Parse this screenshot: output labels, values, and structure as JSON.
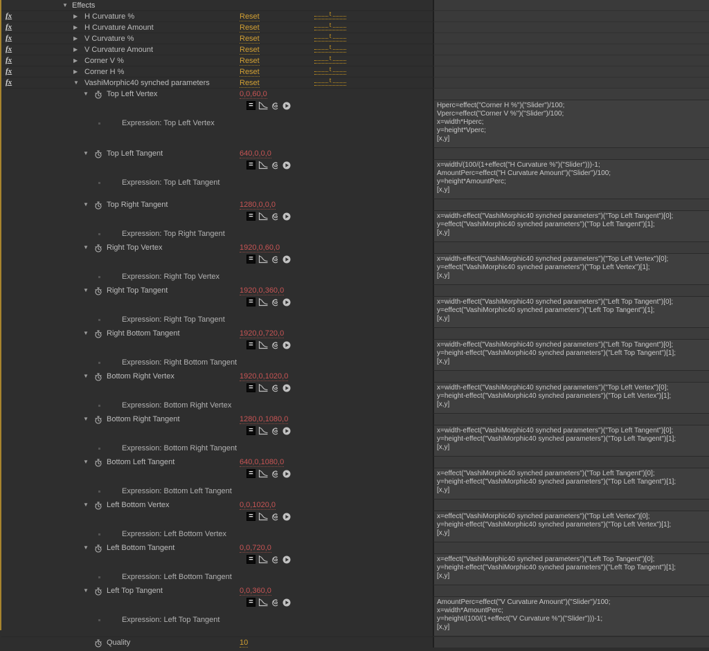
{
  "colors": {
    "hot_text_orange": "#d2a033",
    "keyframed_value_red": "#c75454",
    "panel_bg": "#2e2e2e",
    "track_bg": "#3a3a3a",
    "left_edge_accent": "#a8852e"
  },
  "icons": {
    "twirl_down": "▼",
    "twirl_right": "▶",
    "fx_badge": "fx",
    "enable_expression": "=",
    "post_expression_graph": "graph-curve",
    "pick_whip": "spiral",
    "expression_language_menu": "play-circle",
    "stopwatch": "stopwatch",
    "expression_dots_label": "t"
  },
  "effects_header": {
    "label": "Effects",
    "twirl": "▼"
  },
  "effects": [
    {
      "name": "H Curvature %",
      "twirl": "▶",
      "reset": "Reset"
    },
    {
      "name": "H Curvature Amount",
      "twirl": "▶",
      "reset": "Reset"
    },
    {
      "name": "V Curvature %",
      "twirl": "▶",
      "reset": "Reset"
    },
    {
      "name": "V Curvature Amount",
      "twirl": "▶",
      "reset": "Reset"
    },
    {
      "name": "Corner V %",
      "twirl": "▶",
      "reset": "Reset"
    },
    {
      "name": "Corner H %",
      "twirl": "▶",
      "reset": "Reset"
    },
    {
      "name": "VashiMorphic40 synched parameters",
      "twirl": "▼",
      "reset": "Reset"
    }
  ],
  "parameters": [
    {
      "name": "Top Left Vertex",
      "twirl": "▼",
      "value": "0,0,60,0",
      "expression_label": "Expression: Top Left Vertex",
      "expression": "Hperc=effect(\"Corner H %\")(\"Slider\")/100;\nVperc=effect(\"Corner V %\")(\"Slider\")/100;\nx=width*Hperc;\ny=height*Vperc;\n[x,y]"
    },
    {
      "name": "Top Left Tangent",
      "twirl": "▼",
      "value": "640,0,0,0",
      "expression_label": "Expression: Top Left Tangent",
      "expression": "x=width/(100/(1+effect(\"H Curvature %\")(\"Slider\")))-1;\nAmountPerc=effect(\"H Curvature Amount\")(\"Slider\")/100;\ny=height*AmountPerc;\n[x,y]"
    },
    {
      "name": "Top Right Tangent",
      "twirl": "▼",
      "value": "1280,0,0,0",
      "expression_label": "Expression: Top Right Tangent",
      "expression": "x=width-effect(\"VashiMorphic40 synched parameters\")(\"Top Left Tangent\")[0];\ny=effect(\"VashiMorphic40 synched parameters\")(\"Top Left Tangent\")[1];\n[x,y]"
    },
    {
      "name": "Right Top Vertex",
      "twirl": "▼",
      "value": "1920,0,60,0",
      "expression_label": "Expression: Right Top Vertex",
      "expression": "x=width-effect(\"VashiMorphic40 synched parameters\")(\"Top Left Vertex\")[0];\ny=effect(\"VashiMorphic40 synched parameters\")(\"Top Left Vertex\")[1];\n[x,y]"
    },
    {
      "name": "Right Top Tangent",
      "twirl": "▼",
      "value": "1920,0,360,0",
      "expression_label": "Expression: Right Top Tangent",
      "expression": "x=width-effect(\"VashiMorphic40 synched parameters\")(\"Left Top Tangent\")[0];\ny=effect(\"VashiMorphic40 synched parameters\")(\"Left Top Tangent\")[1];\n[x,y]"
    },
    {
      "name": "Right Bottom Tangent",
      "twirl": "▼",
      "value": "1920,0,720,0",
      "expression_label": "Expression: Right Bottom Tangent",
      "expression": "x=width-effect(\"VashiMorphic40 synched parameters\")(\"Left Top Tangent\")[0];\ny=height-effect(\"VashiMorphic40 synched parameters\")(\"Left Top Tangent\")[1];\n[x,y]"
    },
    {
      "name": "Bottom Right Vertex",
      "twirl": "▼",
      "value": "1920,0,1020,0",
      "expression_label": "Expression: Bottom Right Vertex",
      "expression": "x=width-effect(\"VashiMorphic40 synched parameters\")(\"Top Left Vertex\")[0];\ny=height-effect(\"VashiMorphic40 synched parameters\")(\"Top Left Vertex\")[1];\n[x,y]"
    },
    {
      "name": "Bottom Right Tangent",
      "twirl": "▼",
      "value": "1280,0,1080,0",
      "expression_label": "Expression: Bottom Right Tangent",
      "expression": "x=width-effect(\"VashiMorphic40 synched parameters\")(\"Top Left Tangent\")[0];\ny=height-effect(\"VashiMorphic40 synched parameters\")(\"Top Left Tangent\")[1];\n[x,y]"
    },
    {
      "name": "Bottom Left Tangent",
      "twirl": "▼",
      "value": "640,0,1080,0",
      "expression_label": "Expression: Bottom Left Tangent",
      "expression": "x=effect(\"VashiMorphic40 synched parameters\")(\"Top Left Tangent\")[0];\ny=height-effect(\"VashiMorphic40 synched parameters\")(\"Top Left Tangent\")[1];\n[x,y]"
    },
    {
      "name": "Left Bottom Vertex",
      "twirl": "▼",
      "value": "0,0,1020,0",
      "expression_label": "Expression: Left Bottom Vertex",
      "expression": "x=effect(\"VashiMorphic40 synched parameters\")(\"Top Left Vertex\")[0];\ny=height-effect(\"VashiMorphic40 synched parameters\")(\"Top Left Vertex\")[1];\n[x,y]"
    },
    {
      "name": "Left Bottom Tangent",
      "twirl": "▼",
      "value": "0,0,720,0",
      "expression_label": "Expression: Left Bottom Tangent",
      "expression": "x=effect(\"VashiMorphic40 synched parameters\")(\"Left Top Tangent\")[0];\ny=height-effect(\"VashiMorphic40 synched parameters\")(\"Left Top Tangent\")[1];\n[x,y]"
    },
    {
      "name": "Left Top Tangent",
      "twirl": "▼",
      "value": "0,0,360,0",
      "expression_label": "Expression: Left Top Tangent",
      "expression": "AmountPerc=effect(\"V Curvature Amount\")(\"Slider\")/100;\nx=width*AmountPerc;\ny=height/(100/(1+effect(\"V Curvature %\")(\"Slider\")))-1;\n[x,y]"
    }
  ],
  "quality": {
    "name": "Quality",
    "value": "10"
  }
}
